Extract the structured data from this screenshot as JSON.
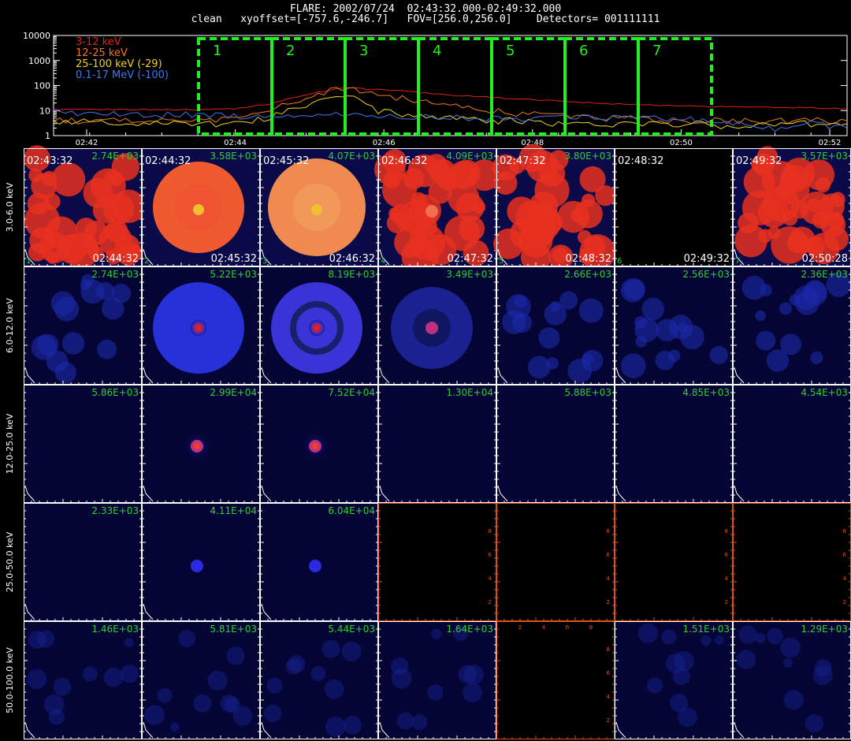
{
  "header": {
    "line1": "FLARE: 2002/07/24  02:43:32.000-02:49:32.000",
    "line2": "clean   xyoffset=[-757.6,-246.7]   FOV=[256.0,256.0]    Detectors= 001111111"
  },
  "colors": {
    "low": "#e02010",
    "mid": "#f07818",
    "high": "#f0d020",
    "gamma": "#3a78f0",
    "box": "#22ee22",
    "grid_border": "#ffffff",
    "empty_border": "#e0501a",
    "peak_label": "#30d030",
    "time_label": "#ffffff"
  },
  "chart_data": [
    {
      "type": "line",
      "title": "",
      "xlabel": "",
      "ylabel": "",
      "yscale": "log",
      "ylim": [
        1,
        10000
      ],
      "xlim_minutes": [
        0,
        11
      ],
      "x_ticks": [
        "02:42",
        "02:44",
        "02:46",
        "02:48",
        "02:50",
        "02:52"
      ],
      "y_ticks": [
        "1",
        "10",
        "100",
        "1000",
        "10000"
      ],
      "legend_position": "top-left",
      "x": [
        0,
        0.5,
        1,
        1.5,
        2,
        2.5,
        3,
        3.5,
        4,
        4.5,
        5,
        5.5,
        6,
        6.5,
        7,
        7.5,
        8,
        8.5,
        9,
        9.5,
        10,
        10.5,
        11
      ],
      "series": [
        {
          "name": "3-12 keV",
          "color": "#e02010",
          "values": [
            11,
            11,
            11,
            11,
            11,
            12,
            18,
            40,
            80,
            70,
            55,
            42,
            35,
            28,
            24,
            20,
            18,
            16,
            15,
            14,
            13,
            13,
            12
          ]
        },
        {
          "name": "12-25 keV",
          "color": "#f07818",
          "values": [
            4,
            4,
            4,
            4,
            4,
            5,
            9,
            30,
            85,
            45,
            25,
            15,
            10,
            8,
            6,
            5,
            5,
            4,
            4,
            4,
            4,
            4,
            4
          ]
        },
        {
          "name": "25-100 keV (-29)",
          "color": "#f0d020",
          "values": [
            3,
            4,
            3,
            3,
            3,
            3,
            5,
            14,
            40,
            10,
            6,
            5,
            4,
            4,
            3,
            3,
            3,
            3,
            3,
            2,
            3,
            3,
            3
          ]
        },
        {
          "name": "0.1-17 MeV (-100)",
          "color": "#3a78f0",
          "values": [
            8,
            7,
            7,
            7,
            7,
            6,
            6,
            6,
            7,
            6,
            6,
            5,
            5,
            5,
            6,
            5,
            5,
            5,
            4,
            3,
            2,
            3,
            2
          ]
        }
      ],
      "intervals": [
        {
          "label": "1",
          "start": 2.0,
          "end": 3.0
        },
        {
          "label": "2",
          "start": 3.0,
          "end": 4.0
        },
        {
          "label": "3",
          "start": 4.0,
          "end": 5.0
        },
        {
          "label": "4",
          "start": 5.0,
          "end": 6.0
        },
        {
          "label": "5",
          "start": 6.0,
          "end": 7.0
        },
        {
          "label": "6",
          "start": 7.0,
          "end": 8.0
        },
        {
          "label": "7",
          "start": 8.0,
          "end": 9.0
        }
      ]
    },
    {
      "type": "heatmap",
      "title": "",
      "rows": [
        "3.0-6.0 keV",
        "6.0-12.0 keV",
        "12.0-25.0 keV",
        "25.0-50.0 keV",
        "50.0-100.0 keV"
      ],
      "columns": [
        "1",
        "2",
        "3",
        "4",
        "5",
        "6",
        "7"
      ],
      "start_times": [
        "02:43:32",
        "02:44:32",
        "02:45:32",
        "02:46:32",
        "02:47:32",
        "02:48:32",
        "02:49:32"
      ],
      "end_times": [
        "02:44:32",
        "02:45:32",
        "02:46:32",
        "02:47:32",
        "02:48:32",
        "02:49:32",
        "02:50:28"
      ],
      "peaks": [
        [
          "2.74E+03",
          "3.58E+03",
          "4.07E+03",
          "4.09E+03",
          "3.80E+03",
          "",
          "3.57E+03"
        ],
        [
          "2.74E+03",
          "5.22E+03",
          "8.19E+03",
          "3.49E+03",
          "2.66E+03",
          "2.56E+03",
          "2.36E+03"
        ],
        [
          "5.86E+03",
          "2.99E+04",
          "7.52E+04",
          "1.30E+04",
          "5.88E+03",
          "4.85E+03",
          "4.54E+03"
        ],
        [
          "2.33E+03",
          "4.11E+04",
          "6.04E+04",
          "",
          "",
          "",
          ""
        ],
        [
          "1.46E+03",
          "5.81E+03",
          "5.44E+03",
          "1.64E+03",
          "",
          "1.51E+03",
          "1.29E+03"
        ]
      ],
      "empty_tick_labels": [
        "2",
        "4",
        "6",
        "8"
      ]
    }
  ]
}
